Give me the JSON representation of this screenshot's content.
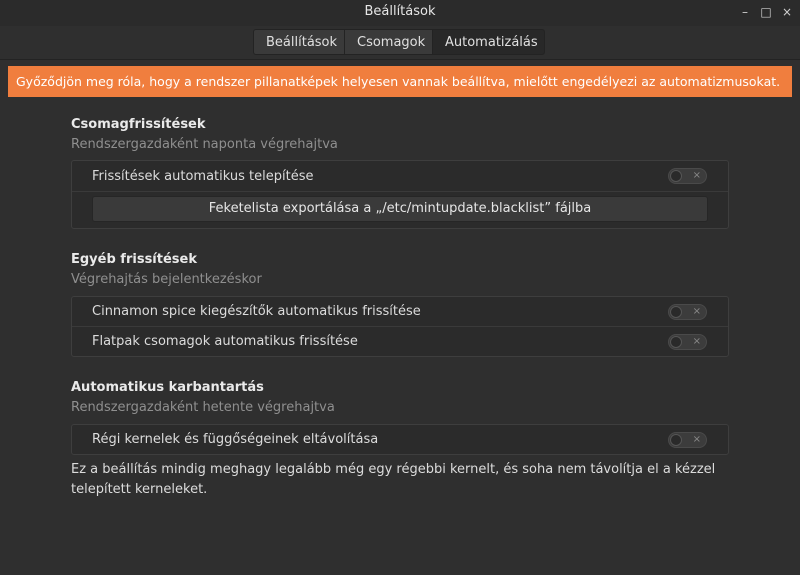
{
  "window": {
    "title": "Beállítások",
    "controls": {
      "minimize": "–",
      "maximize": "□",
      "close": "×"
    }
  },
  "tabs": [
    {
      "label": "Beállítások",
      "active": false
    },
    {
      "label": "Csomagok",
      "active": false
    },
    {
      "label": "Automatizálás",
      "active": true
    }
  ],
  "banner": {
    "text": "Győződjön meg róla, hogy a rendszer pillanatképek helyesen vannak beállítva, mielőtt engedélyezi az automatizmusokat.",
    "color": "#f07e3e"
  },
  "sections": {
    "packages": {
      "title": "Csomagfrissítések",
      "subtitle": "Rendszergazdaként naponta végrehajtva",
      "toggle_label": "Frissítések automatikus telepítése",
      "toggle_on": false,
      "export_button": "Feketelista exportálása a „/etc/mintupdate.blacklist” fájlba"
    },
    "other": {
      "title": "Egyéb frissítések",
      "subtitle": "Végrehajtás bejelentkezéskor",
      "items": [
        {
          "label": "Cinnamon spice kiegészítők automatikus frissítése",
          "on": false
        },
        {
          "label": "Flatpak csomagok automatikus frissítése",
          "on": false
        }
      ]
    },
    "maintenance": {
      "title": "Automatikus karbantartás",
      "subtitle": "Rendszergazdaként hetente végrehajtva",
      "toggle_label": "Régi kernelek és függőségeinek eltávolítása",
      "toggle_on": false,
      "note": "Ez a beállítás mindig meghagy legalább még egy régebbi kernelt, és soha nem távolítja el a kézzel telepített kerneleket."
    }
  },
  "switch_off_symbol": "×"
}
